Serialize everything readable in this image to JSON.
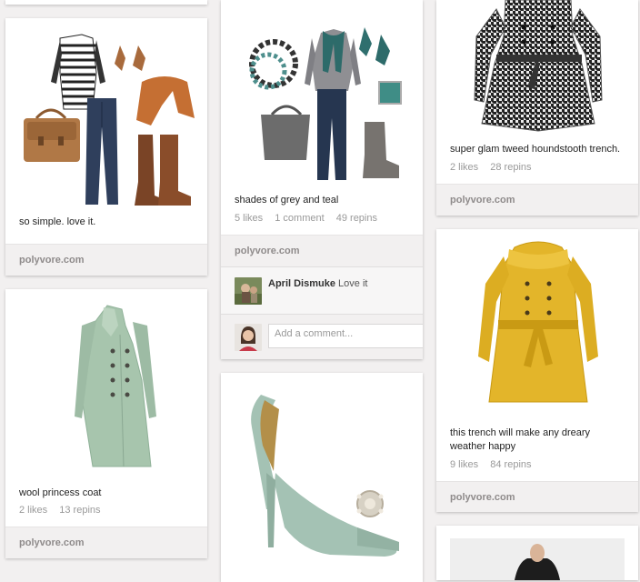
{
  "pins": [
    {
      "id": "pin-outfit-stripes",
      "description": "so simple. love it.",
      "likes": "",
      "repins": "",
      "source": "polyvore.com"
    },
    {
      "id": "pin-wool-coat",
      "description": "wool princess coat",
      "likes": "2 likes",
      "repins": "13 repins",
      "source": "polyvore.com"
    },
    {
      "id": "pin-grey-teal",
      "description": "shades of grey and teal",
      "likes": "5 likes",
      "comments": "1 comment",
      "repins": "49 repins",
      "source": "polyvore.com",
      "comment": {
        "author": "April Dismuke",
        "text": "Love it"
      },
      "comment_input_placeholder": "Add a comment..."
    },
    {
      "id": "pin-houndstooth",
      "description": "super glam tweed houndstooth trench.",
      "likes": "2 likes",
      "repins": "28 repins",
      "source": "polyvore.com"
    },
    {
      "id": "pin-yellow-trench",
      "description_line1": "this trench will make any dreary",
      "description_line2": "weather happy",
      "likes": "9 likes",
      "repins": "84 repins",
      "source": "polyvore.com"
    }
  ],
  "colors": {
    "background": "#f2f0f0",
    "mint": "#9fbfa6",
    "yellow": "#e3b52a",
    "teal": "#2d6b6a"
  },
  "icons": [
    "user-avatar-icon",
    "commenter-avatar-icon"
  ]
}
